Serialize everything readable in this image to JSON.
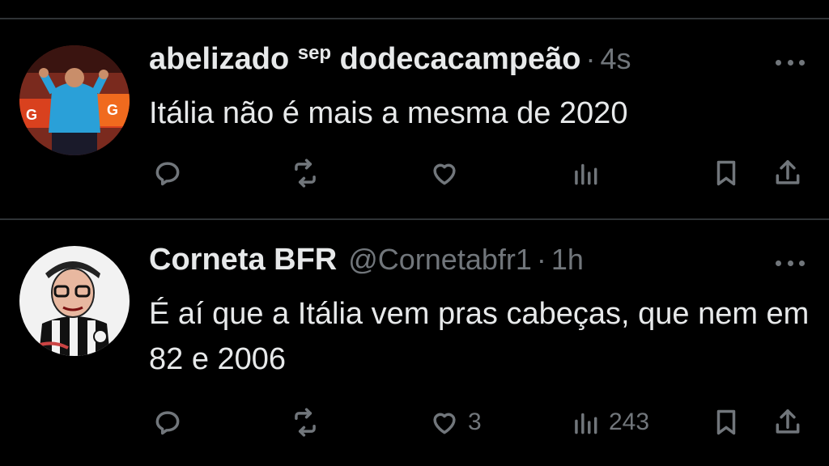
{
  "tweets": [
    {
      "display_name": "abelizado",
      "superscript": "sep",
      "name_suffix": "dodecacampeão",
      "handle": "",
      "separator": "·",
      "time": "4s",
      "text": "Itália não é mais a mesma de 2020",
      "likes": "",
      "views": ""
    },
    {
      "display_name": "Corneta BFR",
      "superscript": "",
      "name_suffix": "",
      "handle": "@Cornetabfr1",
      "separator": "·",
      "time": "1h",
      "text": "É aí que a Itália vem pras cabeças, que nem em 82 e 2006",
      "likes": "3",
      "views": "243"
    }
  ],
  "colors": {
    "background": "#000000",
    "text": "#e7e9ea",
    "muted": "#71767b",
    "divider": "#2f3336"
  },
  "icons": [
    "reply-icon",
    "retweet-icon",
    "like-icon",
    "views-icon",
    "bookmark-icon",
    "share-icon",
    "more-icon"
  ]
}
